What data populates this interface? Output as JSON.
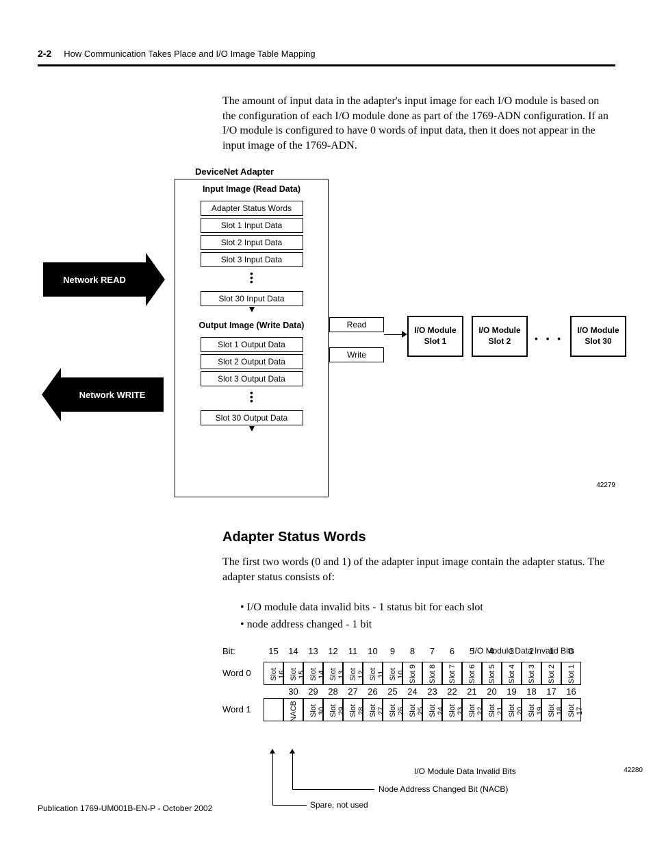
{
  "header": {
    "page_num": "2-2",
    "title": "How Communication Takes Place and I/O Image Table Mapping"
  },
  "p1": "The amount of input data in the adapter's input image for each I/O module is based on the configuration of each I/O module done as part of the 1769-ADN configuration. If an I/O module is configured to have 0 words of input data, then it does not appear in the input image of the 1769-ADN.",
  "diagram": {
    "dn_title": "DeviceNet Adapter",
    "input_title": "Input Image (Read Data)",
    "input_rows": [
      "Adapter Status Words",
      "Slot 1 Input Data",
      "Slot 2 Input Data",
      "Slot 3 Input Data"
    ],
    "input_last": "Slot 30 Input Data",
    "output_title": "Output Image (Write Data)",
    "output_rows": [
      "Slot 1 Output Data",
      "Slot 2 Output Data",
      "Slot 3 Output Data"
    ],
    "output_last": "Slot 30 Output Data",
    "network_read": "Network READ",
    "network_write": "Network WRITE",
    "read": "Read",
    "write": "Write",
    "io1_a": "I/O Module",
    "io1_b": "Slot 1",
    "io2_a": "I/O Module",
    "io2_b": "Slot 2",
    "io30_a": "I/O Module",
    "io30_b": "Slot 30",
    "fig_id1": "42279"
  },
  "section_heading": "Adapter Status Words",
  "p2": "The first two words (0 and 1) of the adapter input image contain the adapter status. The adapter status consists of:",
  "bullets": {
    "b1": "I/O module data invalid bits - 1 status bit for each slot",
    "b2": "node address changed - 1 bit"
  },
  "table": {
    "top_label": "I/O Module Data Invalid Bits",
    "bit_label": "Bit:",
    "word0_label": "Word 0",
    "word1_label": "Word 1",
    "bits_top": [
      "15",
      "14",
      "13",
      "12",
      "11",
      "10",
      "9",
      "8",
      "7",
      "6",
      "5",
      "4",
      "3",
      "2",
      "1",
      "0"
    ],
    "bits_mid": [
      "30",
      "29",
      "28",
      "27",
      "26",
      "25",
      "24",
      "23",
      "22",
      "21",
      "20",
      "19",
      "18",
      "17",
      "16"
    ],
    "w0": [
      "Slot 16",
      "Slot 15",
      "Slot 14",
      "Slot 13",
      "Slot 12",
      "Slot 11",
      "Slot 10",
      "Slot 9",
      "Slot 8",
      "Slot 7",
      "Slot 6",
      "Slot 5",
      "Slot 4",
      "Slot 3",
      "Slot 2",
      "Slot 1"
    ],
    "w1": [
      "",
      "NACB",
      "Slot 30",
      "Slot 29",
      "Slot 28",
      "Slot 27",
      "Slot 26",
      "Slot 25",
      "Slot 24",
      "Slot 23",
      "Slot 22",
      "Slot 21",
      "Slot 20",
      "Slot 19",
      "Slot 18",
      "Slot 17"
    ],
    "callout_invalid": "I/O Module Data Invalid Bits",
    "callout_nacb": "Node Address Changed Bit (NACB)",
    "callout_spare": "Spare, not used",
    "fig_id2": "42280"
  },
  "footer": "Publication 1769-UM001B-EN-P - October 2002"
}
